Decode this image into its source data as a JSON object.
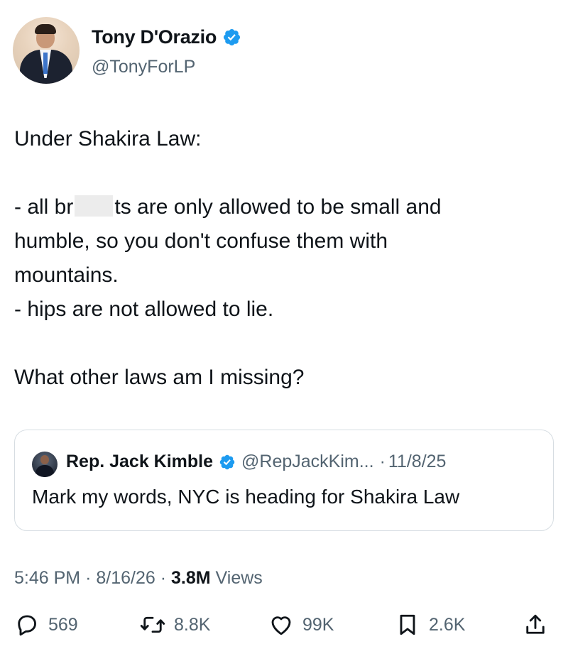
{
  "author": {
    "name": "Tony D'Orazio",
    "handle": "@TonyForLP",
    "verified_icon": "verified-badge-icon",
    "avatar_icon": "profile-photo"
  },
  "tweet": {
    "lines": [
      "Under Shakira Law:",
      "",
      "- all br",
      "ts are only allowed to be small and",
      "humble, so you don't confuse them with",
      "mountains.",
      "- hips are not allowed to lie.",
      "",
      "What other laws am I missing?"
    ]
  },
  "quote": {
    "name": "Rep. Jack Kimble",
    "handle": "@RepJackKim...",
    "separator": "·",
    "date": "11/8/25",
    "text": "Mark my words, NYC is heading for Shakira Law"
  },
  "meta": {
    "time": "5:46 PM",
    "sep1": "·",
    "date": "8/16/26",
    "sep2": "·",
    "views_count": "3.8M",
    "views_label": "Views"
  },
  "actions": {
    "replies": "569",
    "reposts": "8.8K",
    "likes": "99K",
    "bookmarks": "2.6K"
  },
  "colors": {
    "text": "#0f1419",
    "secondary": "#536471",
    "verified": "#1d9bf0",
    "border": "#d6dde2"
  }
}
